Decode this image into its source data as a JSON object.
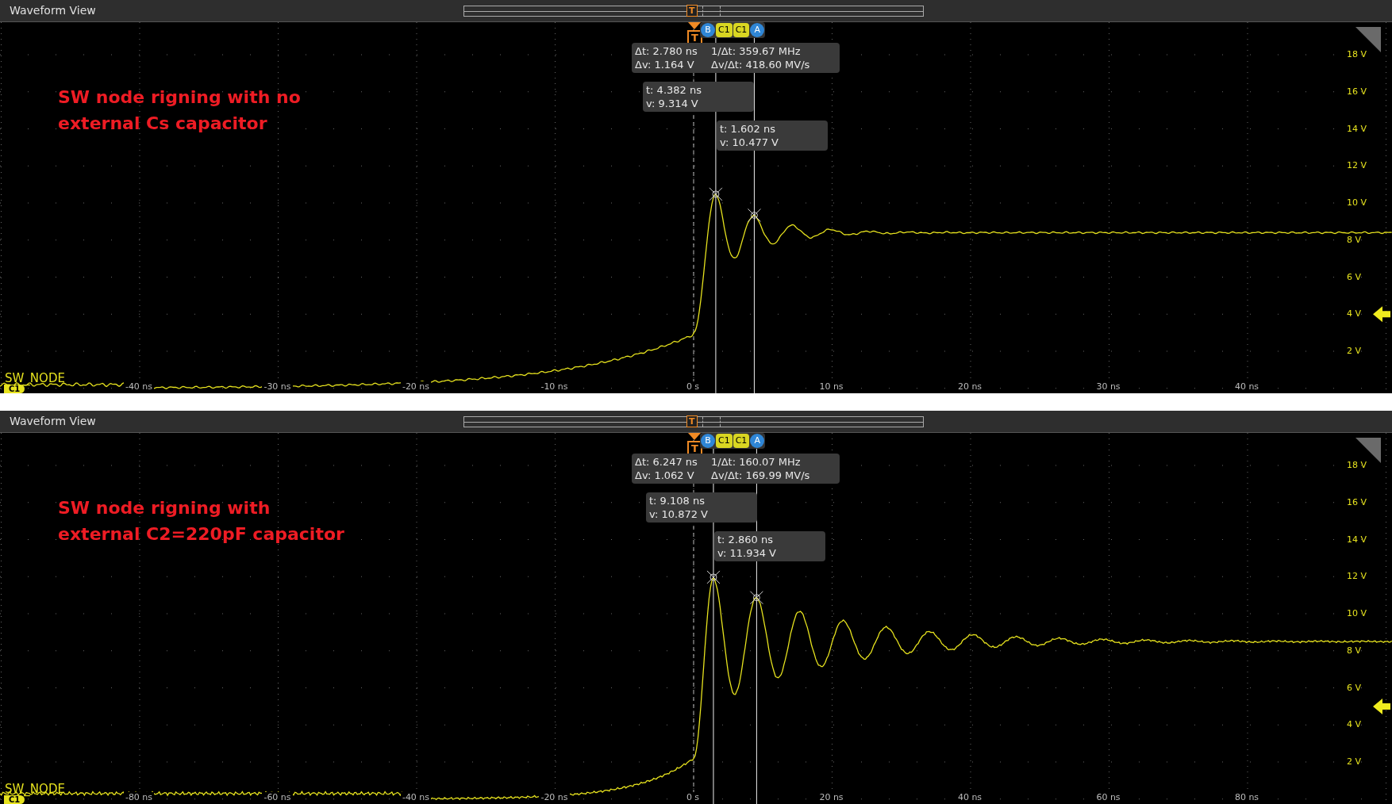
{
  "panels": [
    {
      "title": "Waveform View",
      "overview_trigger": "T",
      "trigger": "T",
      "badges": [
        {
          "label": "B",
          "kind": "cursor"
        },
        {
          "label": "C1",
          "kind": "source"
        },
        {
          "label": "C1",
          "kind": "source"
        },
        {
          "label": "A",
          "kind": "cursor"
        }
      ],
      "annotation": [
        "SW node rigning with no",
        "external Cs capacitor"
      ],
      "delta": {
        "dt": "Δt: 2.780 ns",
        "dv": "Δv: 1.164 V",
        "inv": "1/Δt: 359.67 MHz",
        "slope": "Δv/Δt: 418.60 MV/s"
      },
      "cursor_readouts": [
        {
          "t": "t: 4.382 ns",
          "v": "v: 9.314 V"
        },
        {
          "t": "t: 1.602 ns",
          "v": "v: 10.477 V"
        }
      ],
      "y_ticks": [
        "18 V",
        "16 V",
        "14 V",
        "12 V",
        "10 V",
        "8 V",
        "6 V",
        "4 V",
        "2 V"
      ],
      "x_ticks": [
        "-40 ns",
        "-30 ns",
        "-20 ns",
        "-10 ns",
        "0 s",
        "10 ns",
        "20 ns",
        "30 ns",
        "40 ns"
      ],
      "channel": {
        "name": "SW_NODE",
        "badge": "C1"
      }
    },
    {
      "title": "Waveform View",
      "overview_trigger": "T",
      "trigger": "T",
      "badges": [
        {
          "label": "B",
          "kind": "cursor"
        },
        {
          "label": "C1",
          "kind": "source"
        },
        {
          "label": "C1",
          "kind": "source"
        },
        {
          "label": "A",
          "kind": "cursor"
        }
      ],
      "annotation": [
        "SW node rigning with",
        "external C2=220pF capacitor"
      ],
      "delta": {
        "dt": "Δt: 6.247 ns",
        "dv": "Δv: 1.062 V",
        "inv": "1/Δt: 160.07 MHz",
        "slope": "Δv/Δt: 169.99 MV/s"
      },
      "cursor_readouts": [
        {
          "t": "t: 9.108 ns",
          "v": "v: 10.872 V"
        },
        {
          "t": "t: 2.860 ns",
          "v": "v: 11.934 V"
        }
      ],
      "y_ticks": [
        "18 V",
        "16 V",
        "14 V",
        "12 V",
        "10 V",
        "8 V",
        "6 V",
        "4 V",
        "2 V"
      ],
      "x_ticks": [
        "-80 ns",
        "-60 ns",
        "-40 ns",
        "-20 ns",
        "0 s",
        "20 ns",
        "40 ns",
        "60 ns",
        "80 ns"
      ],
      "channel": {
        "name": "SW_NODE",
        "badge": "C1"
      }
    }
  ]
}
